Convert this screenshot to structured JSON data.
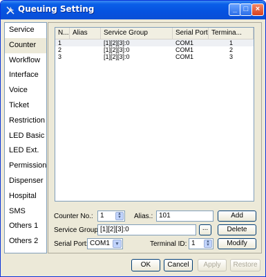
{
  "window": {
    "title": "Queuing Setting",
    "min_symbol": "_",
    "max_symbol": "□",
    "close_symbol": "×"
  },
  "sidebar": {
    "items": [
      {
        "label": "Service"
      },
      {
        "label": "Counter"
      },
      {
        "label": "Workflow"
      },
      {
        "label": "Interface"
      },
      {
        "label": "Voice"
      },
      {
        "label": "Ticket"
      },
      {
        "label": "Restriction"
      },
      {
        "label": "LED Basic"
      },
      {
        "label": "LED Ext."
      },
      {
        "label": "Permission"
      },
      {
        "label": "Dispenser"
      },
      {
        "label": "Hospital"
      },
      {
        "label": "SMS"
      },
      {
        "label": "Others 1"
      },
      {
        "label": "Others 2"
      }
    ],
    "active_index": 1
  },
  "table": {
    "columns": [
      "N...",
      "Alias",
      "Service Group",
      "Serial Port",
      "Termina..."
    ],
    "rows": [
      {
        "no": "1",
        "alias": "",
        "service_group": "[1][2][3]:0",
        "serial_port": "COM1",
        "terminal": "1"
      },
      {
        "no": "2",
        "alias": "",
        "service_group": "[1][2][3]:0",
        "serial_port": "COM1",
        "terminal": "2"
      },
      {
        "no": "3",
        "alias": "",
        "service_group": "[1][2][3]:0",
        "serial_port": "COM1",
        "terminal": "3"
      }
    ]
  },
  "form": {
    "counter_no_label": "Counter No.:",
    "counter_no_value": "1",
    "alias_label": "Alias.:",
    "alias_value": "101",
    "service_group_label": "Service Group:",
    "service_group_value": "[1][2][3]:0",
    "browse_label": "...",
    "serial_port_label": "Serial Port:",
    "serial_port_value": "COM1",
    "terminal_id_label": "Terminal ID:",
    "terminal_id_value": "1",
    "add_label": "Add",
    "delete_label": "Delete",
    "modify_label": "Modify"
  },
  "footer": {
    "ok_label": "OK",
    "cancel_label": "Cancel",
    "apply_label": "Apply",
    "restore_label": "Restore"
  },
  "icons": {
    "spinner_up": "▲",
    "spinner_down": "▼",
    "dropdown": "▼"
  }
}
